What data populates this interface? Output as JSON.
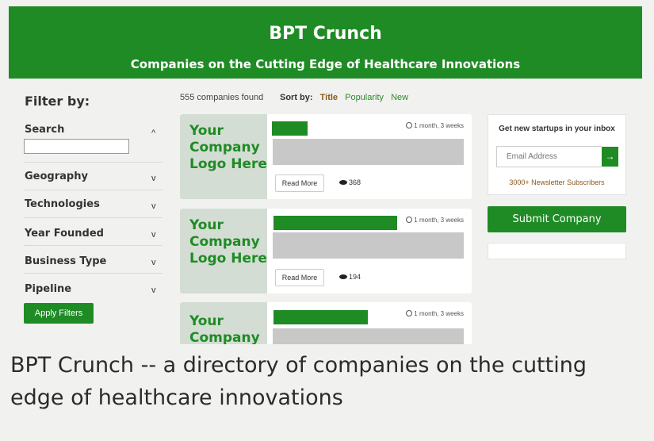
{
  "header": {
    "title": "BPT Crunch",
    "subtitle": "Companies on the Cutting Edge of Healthcare Innovations"
  },
  "filters": {
    "title": "Filter by:",
    "sections": [
      {
        "label": "Search",
        "chevron": "^"
      },
      {
        "label": "Geography",
        "chevron": "v"
      },
      {
        "label": "Technologies",
        "chevron": "v"
      },
      {
        "label": "Year Founded",
        "chevron": "v"
      },
      {
        "label": "Business Type",
        "chevron": "v"
      },
      {
        "label": "Pipeline",
        "chevron": "v"
      }
    ],
    "search_value": "",
    "apply_label": "Apply Filters"
  },
  "results": {
    "count": "555 companies found",
    "sort_label": "Sort by:",
    "sort_options": [
      "Title",
      "Popularity",
      "New"
    ],
    "sort_active": "Title"
  },
  "companies": [
    {
      "logo_text": "Your Company Logo Here",
      "time": "1 month, 3 weeks",
      "read_more": "Read More",
      "views": "368"
    },
    {
      "logo_text": "Your Company Logo Here",
      "time": "1 month, 3 weeks",
      "read_more": "Read More",
      "views": "194"
    },
    {
      "logo_text": "Your Company",
      "time": "1 month, 3 weeks"
    }
  ],
  "sidebar": {
    "newsletter_title": "Get new startups in your inbox",
    "email_placeholder": "Email Address",
    "submit_arrow": "→",
    "subscribers": "3000+ Newsletter Subscribers",
    "submit_company": "Submit Company"
  },
  "caption": "BPT Crunch -- a directory of companies on the cutting edge of healthcare innovations",
  "colors": {
    "brand": "#1f8b25",
    "accent": "#8a5a1a",
    "logo_bg": "#d3ddd3",
    "placeholder_bar": "#c8c8c8"
  },
  "icons": [
    "clock-icon",
    "eye-icon",
    "arrow-right-icon",
    "chevron-up-icon",
    "chevron-down-icon"
  ]
}
